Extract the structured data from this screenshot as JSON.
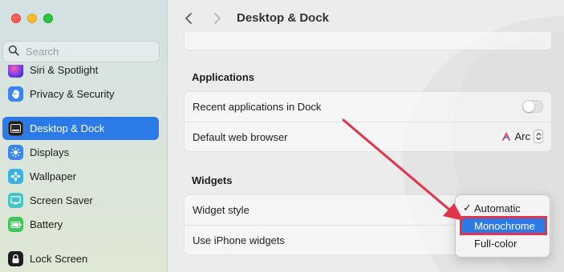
{
  "sidebar": {
    "search_placeholder": "Search",
    "items": [
      {
        "label": "Siri & Spotlight",
        "icon": "siri-icon"
      },
      {
        "label": "Privacy & Security",
        "icon": "hand-icon"
      },
      {
        "label": "Desktop & Dock",
        "icon": "dock-icon",
        "active": true
      },
      {
        "label": "Displays",
        "icon": "sun-icon"
      },
      {
        "label": "Wallpaper",
        "icon": "flower-icon"
      },
      {
        "label": "Screen Saver",
        "icon": "screensaver-icon"
      },
      {
        "label": "Battery",
        "icon": "battery-icon"
      },
      {
        "label": "Lock Screen",
        "icon": "lock-icon"
      }
    ]
  },
  "toolbar": {
    "title": "Desktop & Dock"
  },
  "applications": {
    "heading": "Applications",
    "recent_label": "Recent applications in Dock",
    "recent_enabled": false,
    "browser_label": "Default web browser",
    "browser_value": "Arc"
  },
  "widgets": {
    "heading": "Widgets",
    "style_label": "Widget style",
    "iphone_label": "Use iPhone widgets",
    "style_options": [
      "Automatic",
      "Monochrome",
      "Full-color"
    ],
    "checked_option": "Automatic",
    "highlighted_option": "Monochrome"
  },
  "colors": {
    "accent": "#2c7ae8",
    "annotation": "#e0354a"
  }
}
